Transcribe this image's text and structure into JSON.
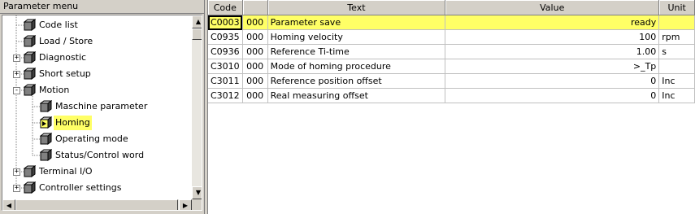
{
  "left_panel": {
    "title": "Parameter menu",
    "tree": [
      {
        "label": "Code list",
        "level": 0,
        "expander": null
      },
      {
        "label": "Load / Store",
        "level": 0,
        "expander": null
      },
      {
        "label": "Diagnostic",
        "level": 0,
        "expander": "+"
      },
      {
        "label": "Short setup",
        "level": 0,
        "expander": "+"
      },
      {
        "label": "Motion",
        "level": 0,
        "expander": "-"
      },
      {
        "label": "Maschine parameter",
        "level": 1,
        "expander": null
      },
      {
        "label": "Homing",
        "level": 1,
        "expander": null,
        "selected": true
      },
      {
        "label": "Operating mode",
        "level": 1,
        "expander": null
      },
      {
        "label": "Status/Control word",
        "level": 1,
        "expander": null
      },
      {
        "label": "Terminal I/O",
        "level": 0,
        "expander": "+"
      },
      {
        "label": "Controller settings",
        "level": 0,
        "expander": "+"
      }
    ],
    "scroll_up": "▲",
    "scroll_down": "▼",
    "scroll_left": "◀",
    "scroll_right": "▶"
  },
  "table": {
    "headers": {
      "code": "Code",
      "sub": "",
      "text": "Text",
      "value": "Value",
      "unit": "Unit"
    },
    "rows": [
      {
        "code": "C0003",
        "sub": "000",
        "text": "Parameter save",
        "value": "ready",
        "unit": "",
        "highlight": true
      },
      {
        "code": "C0935",
        "sub": "000",
        "text": "Homing velocity",
        "value": "100",
        "unit": "rpm"
      },
      {
        "code": "C0936",
        "sub": "000",
        "text": "Reference Ti-time",
        "value": "1.00",
        "unit": "s"
      },
      {
        "code": "C3010",
        "sub": "000",
        "text": "Mode of homing procedure",
        "value": ">_Tp",
        "unit": ""
      },
      {
        "code": "C3011",
        "sub": "000",
        "text": "Reference position offset",
        "value": "0",
        "unit": "Inc"
      },
      {
        "code": "C3012",
        "sub": "000",
        "text": "Real measuring offset",
        "value": "0",
        "unit": "Inc"
      }
    ]
  },
  "colors": {
    "highlight": "#ffff66",
    "panel": "#d4d0c8"
  }
}
